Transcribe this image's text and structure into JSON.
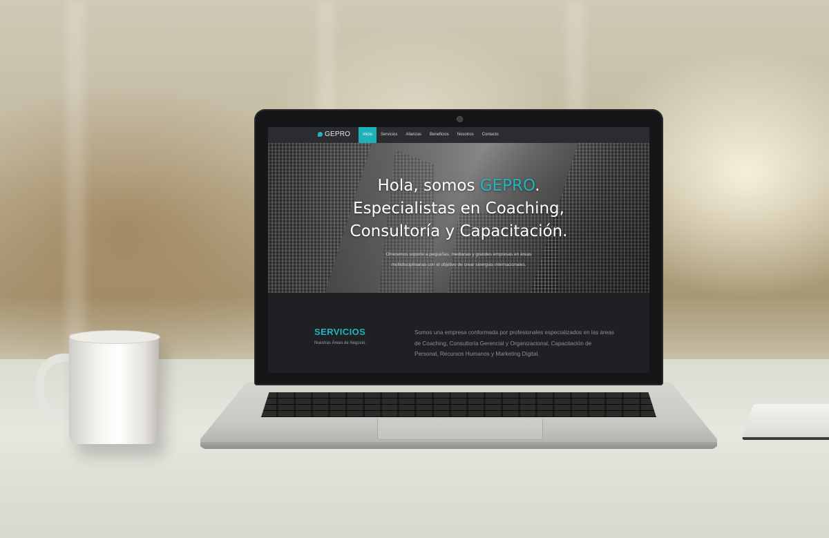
{
  "site": {
    "logo": "GEPRO",
    "nav": [
      "Inicio",
      "Servicios",
      "Alianzas",
      "Beneficios",
      "Nosotros",
      "Contacto"
    ],
    "active_nav": "Inicio",
    "hero": {
      "line1_pre": "Hola, somos ",
      "line1_highlight": "GEPRO",
      "line1_post": ".",
      "line2": "Especialistas en Coaching,",
      "line3": "Consultoría y Capacitación.",
      "subtitle": "Ofrecemos soporte a pequeñas, medianas y grandes empresas en áreas multidisciplinarias con el objetivo de crear sinergias internacionales."
    },
    "services": {
      "title": "SERVICIOS",
      "subtitle": "Nuestras Áreas de Negocio.",
      "description": "Somos una empresa conformada por profesionales especializados en las áreas de Coaching, Consultoría Gerencial y Organizacional, Capacitación de Personal, Recursos Humanos y Marketing Digital."
    }
  },
  "colors": {
    "accent": "#22b5bd",
    "nav_bg": "#2a2c2f",
    "section_bg": "#1e2023"
  }
}
